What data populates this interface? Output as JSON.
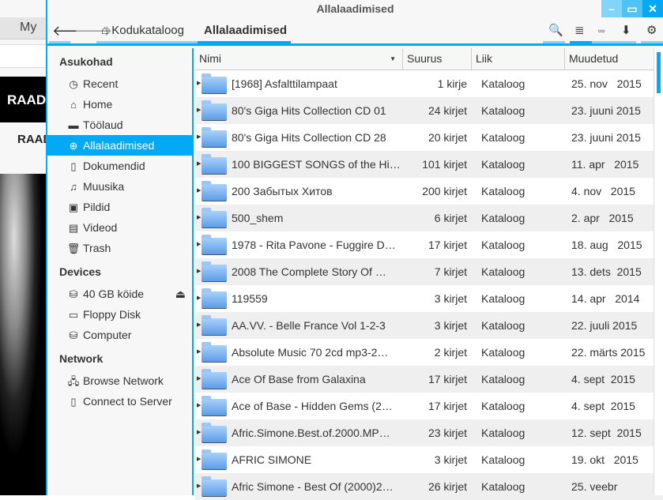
{
  "background_page": {
    "tab_label": "My",
    "banner_text": "RAAD",
    "nav_text": "RAAD"
  },
  "window": {
    "title": "Allalaadimised",
    "accent": "#03a9f4"
  },
  "toolbar": {
    "path": [
      "Kodukataloog",
      "Allalaadimised"
    ]
  },
  "sidebar": {
    "places_header": "Asukohad",
    "places": [
      {
        "label": "Recent",
        "icon": "clock-icon"
      },
      {
        "label": "Home",
        "icon": "home-icon"
      },
      {
        "label": "Töölaud",
        "icon": "folder-icon"
      },
      {
        "label": "Allalaadimised",
        "icon": "download-icon",
        "selected": true
      },
      {
        "label": "Dokumendid",
        "icon": "document-icon"
      },
      {
        "label": "Muusika",
        "icon": "music-icon"
      },
      {
        "label": "Pildid",
        "icon": "picture-icon"
      },
      {
        "label": "Videod",
        "icon": "video-icon"
      },
      {
        "label": "Trash",
        "icon": "trash-icon"
      }
    ],
    "devices_header": "Devices",
    "devices": [
      {
        "label": "40 GB köide",
        "icon": "harddisk-icon"
      },
      {
        "label": "Floppy Disk",
        "icon": "floppy-icon"
      },
      {
        "label": "Computer",
        "icon": "harddisk-icon"
      }
    ],
    "network_header": "Network",
    "network": [
      {
        "label": "Browse Network",
        "icon": "network-icon"
      },
      {
        "label": "Connect to Server",
        "icon": "server-icon"
      }
    ]
  },
  "columns": [
    "Nimi",
    "Suurus",
    "Liik",
    "Muudetud"
  ],
  "rows": [
    [
      "[1968] Asfalttilampaat",
      "1 kirje",
      "Kataloog",
      "25. nov   2015"
    ],
    [
      "80's Giga Hits Collection CD 01",
      "24 kirjet",
      "Kataloog",
      "23. juuni 2015"
    ],
    [
      "80's Giga Hits Collection CD 28",
      "20 kirjet",
      "Kataloog",
      "23. juuni 2015"
    ],
    [
      "100 BIGGEST SONGS of the Hi…",
      "101 kirjet",
      "Kataloog",
      "11. apr   2015"
    ],
    [
      "200 Забытых Хитов",
      "200 kirjet",
      "Kataloog",
      "4. nov   2015"
    ],
    [
      "500_shem",
      "6 kirjet",
      "Kataloog",
      "2. apr   2015"
    ],
    [
      "1978 - Rita Pavone - Fuggire D…",
      "17 kirjet",
      "Kataloog",
      "18. aug   2015"
    ],
    [
      "2008  The Complete Story Of …",
      "7 kirjet",
      "Kataloog",
      "13. dets  2015"
    ],
    [
      "119559",
      "3 kirjet",
      "Kataloog",
      "14. apr   2014"
    ],
    [
      "AA.VV. - Belle France Vol 1-2-3",
      "3 kirjet",
      "Kataloog",
      "22. juuli 2015"
    ],
    [
      "Absolute Music 70 2cd mp3-2…",
      "2 kirjet",
      "Kataloog",
      "22. märts 2015"
    ],
    [
      "Ace Of Base from Galaxina",
      "17 kirjet",
      "Kataloog",
      "4. sept  2015"
    ],
    [
      "Ace of Base - Hidden Gems (2…",
      "17 kirjet",
      "Kataloog",
      "4. sept  2015"
    ],
    [
      "Afric.Simone.Best.of.2000.MP…",
      "23 kirjet",
      "Kataloog",
      "12. sept  2015"
    ],
    [
      "AFRIC SIMONE",
      "3 kirjet",
      "Kataloog",
      "19. okt   2015"
    ],
    [
      "Afric Simone - Best Of (2000)2…",
      "26 kirjet",
      "Kataloog",
      "25. veebr"
    ]
  ]
}
